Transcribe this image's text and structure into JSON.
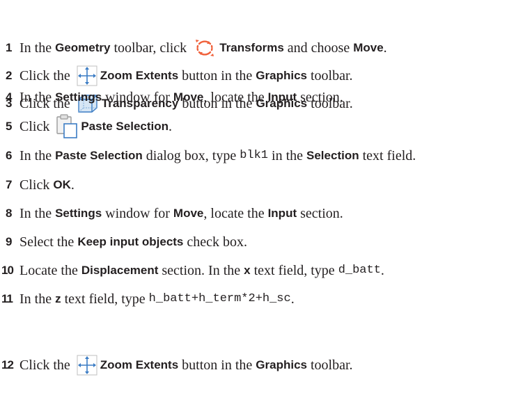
{
  "steps": [
    {
      "n": "1",
      "parts": [
        "In the ",
        "Geometry",
        " toolbar, click ",
        "Transforms",
        " and choose ",
        "Move",
        "."
      ]
    },
    {
      "n": "2",
      "parts": [
        "Click the ",
        "Zoom Extents",
        " button in the ",
        "Graphics",
        " toolbar."
      ]
    },
    {
      "n": "3",
      "parts": [
        "Click the ",
        "Transparency",
        " button in the ",
        "Graphics",
        " toolbar."
      ]
    },
    {
      "n": "4",
      "parts": [
        "In the ",
        "Settings",
        " window for ",
        "Move",
        ", locate the ",
        "Input",
        " section."
      ]
    },
    {
      "n": "5",
      "parts": [
        "Click ",
        "Paste Selection",
        "."
      ]
    },
    {
      "n": "6",
      "parts": [
        "In the ",
        "Paste Selection",
        " dialog box, type ",
        "blk1",
        " in the ",
        "Selection",
        " text field."
      ]
    },
    {
      "n": "7",
      "parts": [
        "Click ",
        "OK",
        "."
      ]
    },
    {
      "n": "8",
      "parts": [
        "In the ",
        "Settings",
        " window for ",
        "Move",
        ", locate the ",
        "Input",
        " section."
      ]
    },
    {
      "n": "9",
      "parts": [
        "Select the ",
        "Keep input objects",
        " check box."
      ]
    },
    {
      "n": "10",
      "parts": [
        "Locate the ",
        "Displacement",
        " section. In the ",
        "x",
        " text field, type ",
        "d_batt",
        "."
      ]
    },
    {
      "n": "11",
      "parts": [
        "In the ",
        "z",
        " text field, type ",
        "h_batt+h_term*2+h_sc",
        "."
      ]
    },
    {
      "n": "12",
      "parts": [
        "Click the ",
        "Zoom Extents",
        " button in the ",
        "Graphics",
        " toolbar."
      ]
    }
  ],
  "icons": {
    "transforms": "transforms-icon",
    "zoom_extents": "zoom-extents-icon",
    "transparency": "transparency-icon",
    "paste_selection": "paste-selection-icon"
  },
  "colors": {
    "text": "#231f20",
    "transforms_icon": "#f0603a",
    "icon_blue": "#3b7cc4"
  }
}
